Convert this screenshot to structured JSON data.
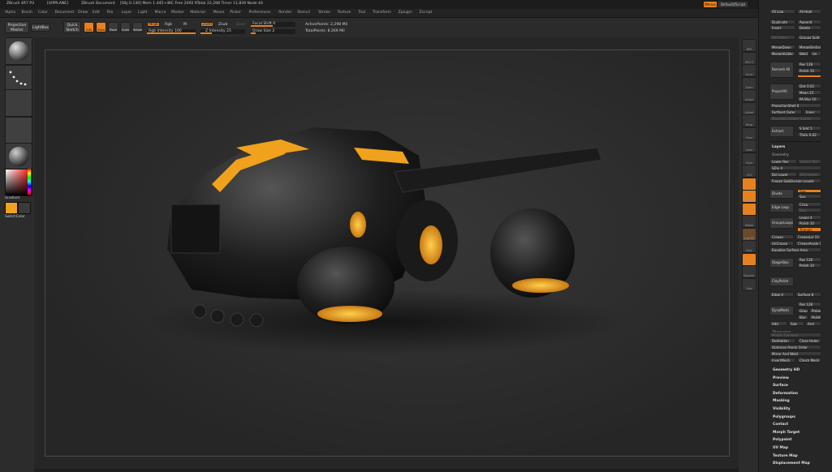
{
  "title_bar": {
    "app": "ZBrush 4R7 P3",
    "ui_mode": "[UIPPLANE]",
    "document": "ZBrush Document",
    "stats": "[Obj 0.130]  Mem 1.445+4KC  Free 2092  RTotal 22,298  Timer 11,839  Node 44",
    "right_button": "Menus",
    "right_script": "DefaultZScript"
  },
  "menu": [
    "Alpha",
    "Brush",
    "Color",
    "Document",
    "Draw",
    "Edit",
    "File",
    "Layer",
    "Light",
    "Macro",
    "Marker",
    "Material",
    "Movie",
    "Picker",
    "Preferences",
    "Render",
    "Stencil",
    "Stroke",
    "Texture",
    "Tool",
    "Transform",
    "Zplugin",
    "Zscript"
  ],
  "toolbar": {
    "projection_master": "Projection Master",
    "lightbox": "LightBox",
    "quick_sketch": "Quick Sketch",
    "edit": "Edit",
    "draw": "Draw",
    "move": "Move",
    "scale": "Scale",
    "rotate": "Rotate",
    "mrgb": "Mrgb",
    "rgb": "Rgb",
    "m": "M",
    "rgb_intensity": "Rgb Intensity 100",
    "zadd": "Zadd",
    "zsub": "Zsub",
    "zcut": "Zcut",
    "z_intensity": "Z Intensity 25",
    "focal_shift": "Focal Shift 0",
    "draw_size": "Draw Size 2",
    "active_points": "ActivePoints: 2,298 Mil",
    "total_points": "TotalPoints: 8.269 Mil"
  },
  "left_panel": {
    "gradient_label": "Gradient",
    "switch_color_label": "SwitchColor",
    "main_color": "#f0a21c",
    "secondary_color": "#3a3a3a"
  },
  "right_tools": [
    "BPR",
    "SPix 3",
    "Scroll",
    "Zoom",
    "Actual",
    "AAHalf",
    "Persp",
    "Floor",
    "Local",
    "LSym",
    "XYZ",
    "Frame",
    "Move",
    "Scale",
    "Rotate",
    "Line Fill",
    "PolyF",
    "Transp",
    "Dynamic",
    "Solo"
  ],
  "subtool_panel": {
    "all_low": "All Low",
    "all_high": "All High",
    "duplicate": "Duplicate",
    "append": "Append",
    "insert": "Insert",
    "delete": "Delete",
    "del_other": "Del Other",
    "groups_split": "Groups Split",
    "merge_down": "MergeDown",
    "merge_similar": "MergeSimilar",
    "merge_visible": "MergeVisible",
    "weld": "Weld",
    "uv": "Uv",
    "remesh_all": "Remesh All",
    "res_label": "Res 128",
    "polish_label": "Polish 10",
    "project_all": "ProjectAll",
    "dist": "Dist 0.02",
    "mean": "Mean 25",
    "pa_blur": "PA Blur 10",
    "project_shell": "ProjectionShell 0",
    "farthest": "Farthest Outer",
    "inner": "Inner",
    "reproject_higher": "Reproject Higher Subdiv",
    "extract": "Extract",
    "s_smt": "S Smt 5",
    "thick": "Thick 0.02"
  },
  "layers_label": "Layers",
  "geometry": {
    "header": "Geometry",
    "lower_res": "Lower Res",
    "higher_res": "Higher Res",
    "sdiv": "SDiv 4",
    "del_lower": "Del Lower",
    "del_higher": "Del Higher",
    "freeze": "Freeze SubDivision Levels",
    "divide": "Divide",
    "smt": "Smt",
    "suv": "Suv",
    "edge_loop": "Edge Loop",
    "crisp": "Crisp",
    "disp": "Disp",
    "groups_loops": "GroupsLoops",
    "loops": "Loops 4",
    "polish": "Polish 10",
    "triangle": "Triangle",
    "crease": "Crease",
    "crease_lvl": "CreaseLvl 15",
    "uncrease": "UnCrease",
    "crease_ang": "CreaseAngle 15",
    "equalize": "Equalize Surface Area",
    "stager": "StagerBox",
    "res_stager": "Res 128",
    "polish_stager": "Polish 10",
    "claypolish": "ClayPolish",
    "edge": "Edge 0",
    "surface": "Surface 8",
    "dynamesh": "DynaMesh",
    "res_dyn": "Res 128",
    "group": "Group",
    "project": "Project",
    "blur": "Blur",
    "polish_dyn": "Polish",
    "add": "Add",
    "sub": "Sub",
    "and": "And",
    "zremesher": "ZRemesher",
    "modify_topology": "Modify Topology",
    "delhidden": "DelHidden",
    "close_holes": "Close Holes",
    "optimize": "Optimize Points Order",
    "mirror_weld": "Mirror And Weld",
    "insert_mesh": "InsertMesh",
    "check_mesh": "Check Mesh"
  },
  "palettes": [
    "Geometry HD",
    "Preview",
    "Surface",
    "Deformation",
    "Masking",
    "Visibility",
    "Polygroups",
    "Contact",
    "Morph Target",
    "Polypaint",
    "UV Map",
    "Texture Map",
    "Displacement Map"
  ]
}
